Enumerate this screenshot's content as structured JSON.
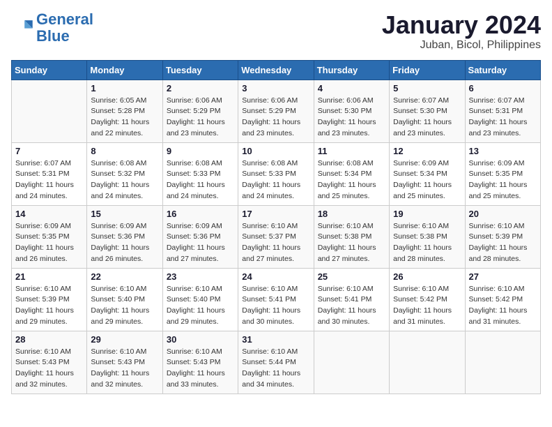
{
  "header": {
    "logo_line1": "General",
    "logo_line2": "Blue",
    "month_title": "January 2024",
    "location": "Juban, Bicol, Philippines"
  },
  "weekdays": [
    "Sunday",
    "Monday",
    "Tuesday",
    "Wednesday",
    "Thursday",
    "Friday",
    "Saturday"
  ],
  "weeks": [
    [
      {
        "day": "",
        "info": ""
      },
      {
        "day": "1",
        "info": "Sunrise: 6:05 AM\nSunset: 5:28 PM\nDaylight: 11 hours\nand 22 minutes."
      },
      {
        "day": "2",
        "info": "Sunrise: 6:06 AM\nSunset: 5:29 PM\nDaylight: 11 hours\nand 23 minutes."
      },
      {
        "day": "3",
        "info": "Sunrise: 6:06 AM\nSunset: 5:29 PM\nDaylight: 11 hours\nand 23 minutes."
      },
      {
        "day": "4",
        "info": "Sunrise: 6:06 AM\nSunset: 5:30 PM\nDaylight: 11 hours\nand 23 minutes."
      },
      {
        "day": "5",
        "info": "Sunrise: 6:07 AM\nSunset: 5:30 PM\nDaylight: 11 hours\nand 23 minutes."
      },
      {
        "day": "6",
        "info": "Sunrise: 6:07 AM\nSunset: 5:31 PM\nDaylight: 11 hours\nand 23 minutes."
      }
    ],
    [
      {
        "day": "7",
        "info": "Sunrise: 6:07 AM\nSunset: 5:31 PM\nDaylight: 11 hours\nand 24 minutes."
      },
      {
        "day": "8",
        "info": "Sunrise: 6:08 AM\nSunset: 5:32 PM\nDaylight: 11 hours\nand 24 minutes."
      },
      {
        "day": "9",
        "info": "Sunrise: 6:08 AM\nSunset: 5:33 PM\nDaylight: 11 hours\nand 24 minutes."
      },
      {
        "day": "10",
        "info": "Sunrise: 6:08 AM\nSunset: 5:33 PM\nDaylight: 11 hours\nand 24 minutes."
      },
      {
        "day": "11",
        "info": "Sunrise: 6:08 AM\nSunset: 5:34 PM\nDaylight: 11 hours\nand 25 minutes."
      },
      {
        "day": "12",
        "info": "Sunrise: 6:09 AM\nSunset: 5:34 PM\nDaylight: 11 hours\nand 25 minutes."
      },
      {
        "day": "13",
        "info": "Sunrise: 6:09 AM\nSunset: 5:35 PM\nDaylight: 11 hours\nand 25 minutes."
      }
    ],
    [
      {
        "day": "14",
        "info": "Sunrise: 6:09 AM\nSunset: 5:35 PM\nDaylight: 11 hours\nand 26 minutes."
      },
      {
        "day": "15",
        "info": "Sunrise: 6:09 AM\nSunset: 5:36 PM\nDaylight: 11 hours\nand 26 minutes."
      },
      {
        "day": "16",
        "info": "Sunrise: 6:09 AM\nSunset: 5:36 PM\nDaylight: 11 hours\nand 27 minutes."
      },
      {
        "day": "17",
        "info": "Sunrise: 6:10 AM\nSunset: 5:37 PM\nDaylight: 11 hours\nand 27 minutes."
      },
      {
        "day": "18",
        "info": "Sunrise: 6:10 AM\nSunset: 5:38 PM\nDaylight: 11 hours\nand 27 minutes."
      },
      {
        "day": "19",
        "info": "Sunrise: 6:10 AM\nSunset: 5:38 PM\nDaylight: 11 hours\nand 28 minutes."
      },
      {
        "day": "20",
        "info": "Sunrise: 6:10 AM\nSunset: 5:39 PM\nDaylight: 11 hours\nand 28 minutes."
      }
    ],
    [
      {
        "day": "21",
        "info": "Sunrise: 6:10 AM\nSunset: 5:39 PM\nDaylight: 11 hours\nand 29 minutes."
      },
      {
        "day": "22",
        "info": "Sunrise: 6:10 AM\nSunset: 5:40 PM\nDaylight: 11 hours\nand 29 minutes."
      },
      {
        "day": "23",
        "info": "Sunrise: 6:10 AM\nSunset: 5:40 PM\nDaylight: 11 hours\nand 29 minutes."
      },
      {
        "day": "24",
        "info": "Sunrise: 6:10 AM\nSunset: 5:41 PM\nDaylight: 11 hours\nand 30 minutes."
      },
      {
        "day": "25",
        "info": "Sunrise: 6:10 AM\nSunset: 5:41 PM\nDaylight: 11 hours\nand 30 minutes."
      },
      {
        "day": "26",
        "info": "Sunrise: 6:10 AM\nSunset: 5:42 PM\nDaylight: 11 hours\nand 31 minutes."
      },
      {
        "day": "27",
        "info": "Sunrise: 6:10 AM\nSunset: 5:42 PM\nDaylight: 11 hours\nand 31 minutes."
      }
    ],
    [
      {
        "day": "28",
        "info": "Sunrise: 6:10 AM\nSunset: 5:43 PM\nDaylight: 11 hours\nand 32 minutes."
      },
      {
        "day": "29",
        "info": "Sunrise: 6:10 AM\nSunset: 5:43 PM\nDaylight: 11 hours\nand 32 minutes."
      },
      {
        "day": "30",
        "info": "Sunrise: 6:10 AM\nSunset: 5:43 PM\nDaylight: 11 hours\nand 33 minutes."
      },
      {
        "day": "31",
        "info": "Sunrise: 6:10 AM\nSunset: 5:44 PM\nDaylight: 11 hours\nand 34 minutes."
      },
      {
        "day": "",
        "info": ""
      },
      {
        "day": "",
        "info": ""
      },
      {
        "day": "",
        "info": ""
      }
    ]
  ]
}
